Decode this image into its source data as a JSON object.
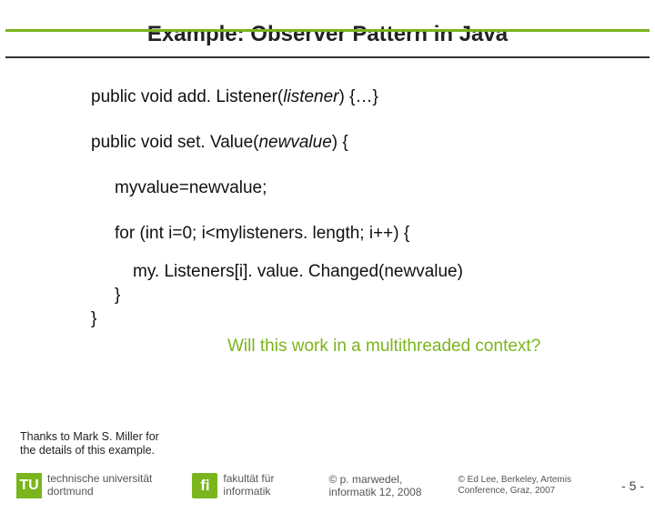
{
  "title": "Example: Observer Pattern in Java",
  "code": {
    "line1_a": "public void add. Listener(",
    "line1_b": "listener",
    "line1_c": ") {…}",
    "line2_a": "public void set. Value(",
    "line2_b": "newvalue",
    "line2_c": ") {",
    "line3": "myvalue=newvalue;",
    "line4": "for (int i=0; i<mylisteners. length; i++) {",
    "line5": "my. Listeners[i]. value. Changed(newvalue)",
    "line6": "}",
    "line7": "}"
  },
  "question": "Will this work in a multithreaded context?",
  "thanks": {
    "l1": "Thanks to Mark S. Miller for",
    "l2": "the details of this example."
  },
  "footer": {
    "tu_mark": "TU",
    "tu_l1": "technische universität",
    "tu_l2": "dortmund",
    "fi_mark": "fi",
    "fi_l1": "fakultät für",
    "fi_l2": "informatik",
    "copy_l1": "© p. marwedel,",
    "copy_l2": "informatik 12, 2008",
    "attr_l1": "© Ed Lee, Berkeley, Artemis",
    "attr_l2": "Conference, Graz, 2007",
    "page": "- 5 -"
  }
}
